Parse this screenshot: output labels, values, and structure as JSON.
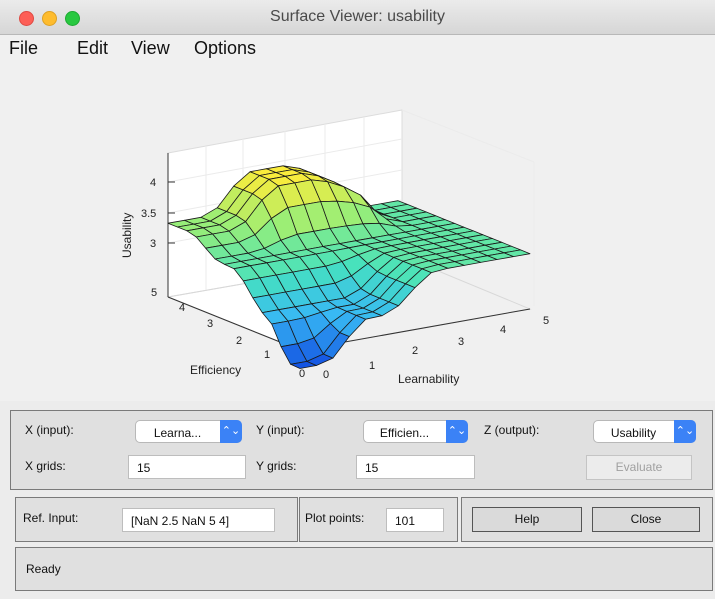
{
  "window": {
    "title": "Surface Viewer: usability"
  },
  "menu": [
    "File",
    "Edit",
    "View",
    "Options"
  ],
  "plot": {
    "z_axis_label": "Usability",
    "y_axis_label": "Efficiency",
    "x_axis_label": "Learnability",
    "z_ticks": [
      "4",
      "3.5",
      "3"
    ],
    "y_ticks": [
      "5",
      "4",
      "3",
      "2",
      "1",
      "0"
    ],
    "x_ticks": [
      "0",
      "1",
      "2",
      "3",
      "4",
      "5"
    ]
  },
  "controls": {
    "x_input_label": "X (input):",
    "x_input_value": "Learna...",
    "y_input_label": "Y (input):",
    "y_input_value": "Efficien...",
    "z_output_label": "Z (output):",
    "z_output_value": "Usability",
    "x_grids_label": "X grids:",
    "x_grids_value": "15",
    "y_grids_label": "Y grids:",
    "y_grids_value": "15",
    "evaluate_label": "Evaluate",
    "ref_input_label": "Ref. Input:",
    "ref_input_value": "[NaN 2.5 NaN 5 4]",
    "plot_points_label": "Plot points:",
    "plot_points_value": "101",
    "help_label": "Help",
    "close_label": "Close"
  },
  "status": "Ready",
  "colors": {
    "surface_low": "#1d62e6",
    "surface_mid": "#49e0c0",
    "surface_high": "#f7ee4e"
  }
}
